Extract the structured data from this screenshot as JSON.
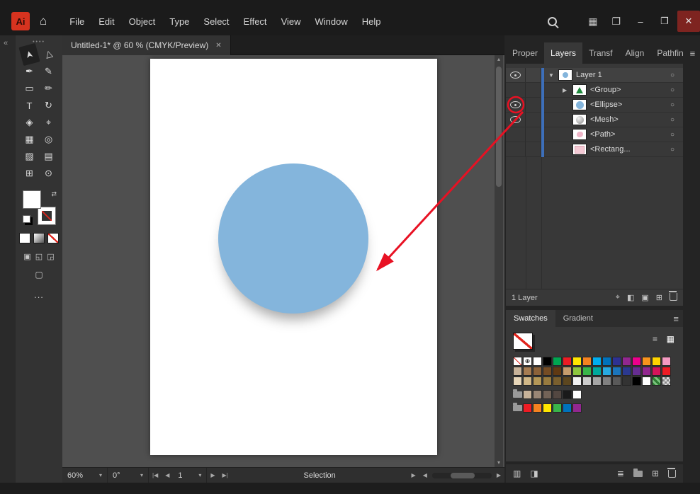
{
  "titlebar": {
    "logo_text": "Ai",
    "menus": [
      "File",
      "Edit",
      "Object",
      "Type",
      "Select",
      "Effect",
      "View",
      "Window",
      "Help"
    ],
    "window_controls": {
      "minimize": "–",
      "restore": "❐",
      "close": "✕"
    }
  },
  "document_tab": {
    "title": "Untitled-1* @ 60 % (CMYK/Preview)",
    "close_glyph": "✕"
  },
  "toolbar": {
    "tools": [
      {
        "name": "selection-tool",
        "glyph": "➤",
        "selected": true,
        "rotate": -105
      },
      {
        "name": "direct-selection-tool",
        "glyph": "▷",
        "rotate": -105
      },
      {
        "name": "pen-tool",
        "glyph": "✒"
      },
      {
        "name": "curvature-tool",
        "glyph": "✎"
      },
      {
        "name": "rectangle-tool",
        "glyph": "▭"
      },
      {
        "name": "paintbrush-tool",
        "glyph": "✏"
      },
      {
        "name": "type-tool",
        "glyph": "T"
      },
      {
        "name": "rotate-tool",
        "glyph": "↻"
      },
      {
        "name": "eraser-tool",
        "glyph": "◈"
      },
      {
        "name": "scale-tool",
        "glyph": "⌖"
      },
      {
        "name": "mesh-tool",
        "glyph": "▦"
      },
      {
        "name": "eyedropper-tool",
        "glyph": "◎"
      },
      {
        "name": "symbol-sprayer-tool",
        "glyph": "▨"
      },
      {
        "name": "graph-tool",
        "glyph": "▤"
      },
      {
        "name": "artboard-tool",
        "glyph": "⊞"
      },
      {
        "name": "zoom-tool",
        "glyph": "⊙"
      }
    ],
    "draw_modes": [
      "▣",
      "◱",
      "◲"
    ],
    "overflow_label": "..."
  },
  "layers_panel": {
    "tabs": [
      "Proper",
      "Layers",
      "Transf",
      "Align",
      "Pathfin"
    ],
    "active_tab": "Layers",
    "rows": [
      {
        "label": "Layer 1"
      },
      {
        "label": "<Group>"
      },
      {
        "label": "<Ellipse>"
      },
      {
        "label": "<Mesh>"
      },
      {
        "label": "<Path>"
      },
      {
        "label": "<Rectang..."
      }
    ],
    "footer_label": "1 Layer"
  },
  "swatches_panel": {
    "tabs": [
      "Swatches",
      "Gradient"
    ],
    "active_tab": "Swatches",
    "grid": [
      [
        "none",
        "reg",
        "#ffffff",
        "#000000",
        "#00a651",
        "#ed1c24",
        "#ffe600",
        "#f58220",
        "#00aeef",
        "#0072bc",
        "#2e3192",
        "#92278f",
        "#ec008c",
        "#f7941d",
        "#ffd400",
        "#f49ac1"
      ],
      [
        "#c7b299",
        "#a67c52",
        "#8c6239",
        "#754c24",
        "#603913",
        "#c69c6d",
        "#8dc63f",
        "#39b54a",
        "#00a99d",
        "#27aae1",
        "#1b75bb",
        "#2b3990",
        "#662d91",
        "#92278f",
        "#d4145a",
        "#ed1c24"
      ],
      [
        "#e6d5b8",
        "#d0b787",
        "#b49757",
        "#987b3f",
        "#7a5f2e",
        "#5c461f",
        "#f2f2f2",
        "#cccccc",
        "#a6a6a6",
        "#808080",
        "#595959",
        "#333333",
        "#000000",
        "#ffffff",
        "pattern-green",
        "pattern-checker"
      ],
      [
        "folder",
        "#c7b299",
        "#998675",
        "#736357",
        "#534741",
        "#1a1a1a",
        "#ffffff"
      ],
      [
        "folder",
        "#ed1c24",
        "#f58220",
        "#ffe600",
        "#39b54a",
        "#0072bc",
        "#92278f"
      ]
    ]
  },
  "statusbar": {
    "zoom": "60%",
    "rotation": "0°",
    "artboard": "1",
    "status_label": "Selection"
  },
  "colors": {
    "annotation_red": "#e81123",
    "ellipse_blue": "#84b5dc",
    "selection_blue": "#3d6fba",
    "canvas_gray": "#4f4f4f"
  },
  "glyphs": {
    "home": "⌂",
    "workspace": "▦",
    "arrange": "❐",
    "collapse_left": "«",
    "drag_dots": "••••",
    "swap": "⇄",
    "screen_mode": "▢",
    "chevron_down": "▾",
    "caret_down": "▼",
    "caret_right": "▶",
    "target": "○",
    "hamburger": "≡",
    "list_view": "≡",
    "grid_view": "▦",
    "nav_first": "|◀",
    "nav_prev": "◀",
    "nav_next": "▶",
    "nav_last": "▶|",
    "tri_up": "▴",
    "tri_down": "▾",
    "locate": "⌖",
    "clip_mask": "◧",
    "new_sublayer": "▣",
    "new_item": "⊞",
    "libraries": "▥",
    "kinds": "◨",
    "options": "≣"
  }
}
